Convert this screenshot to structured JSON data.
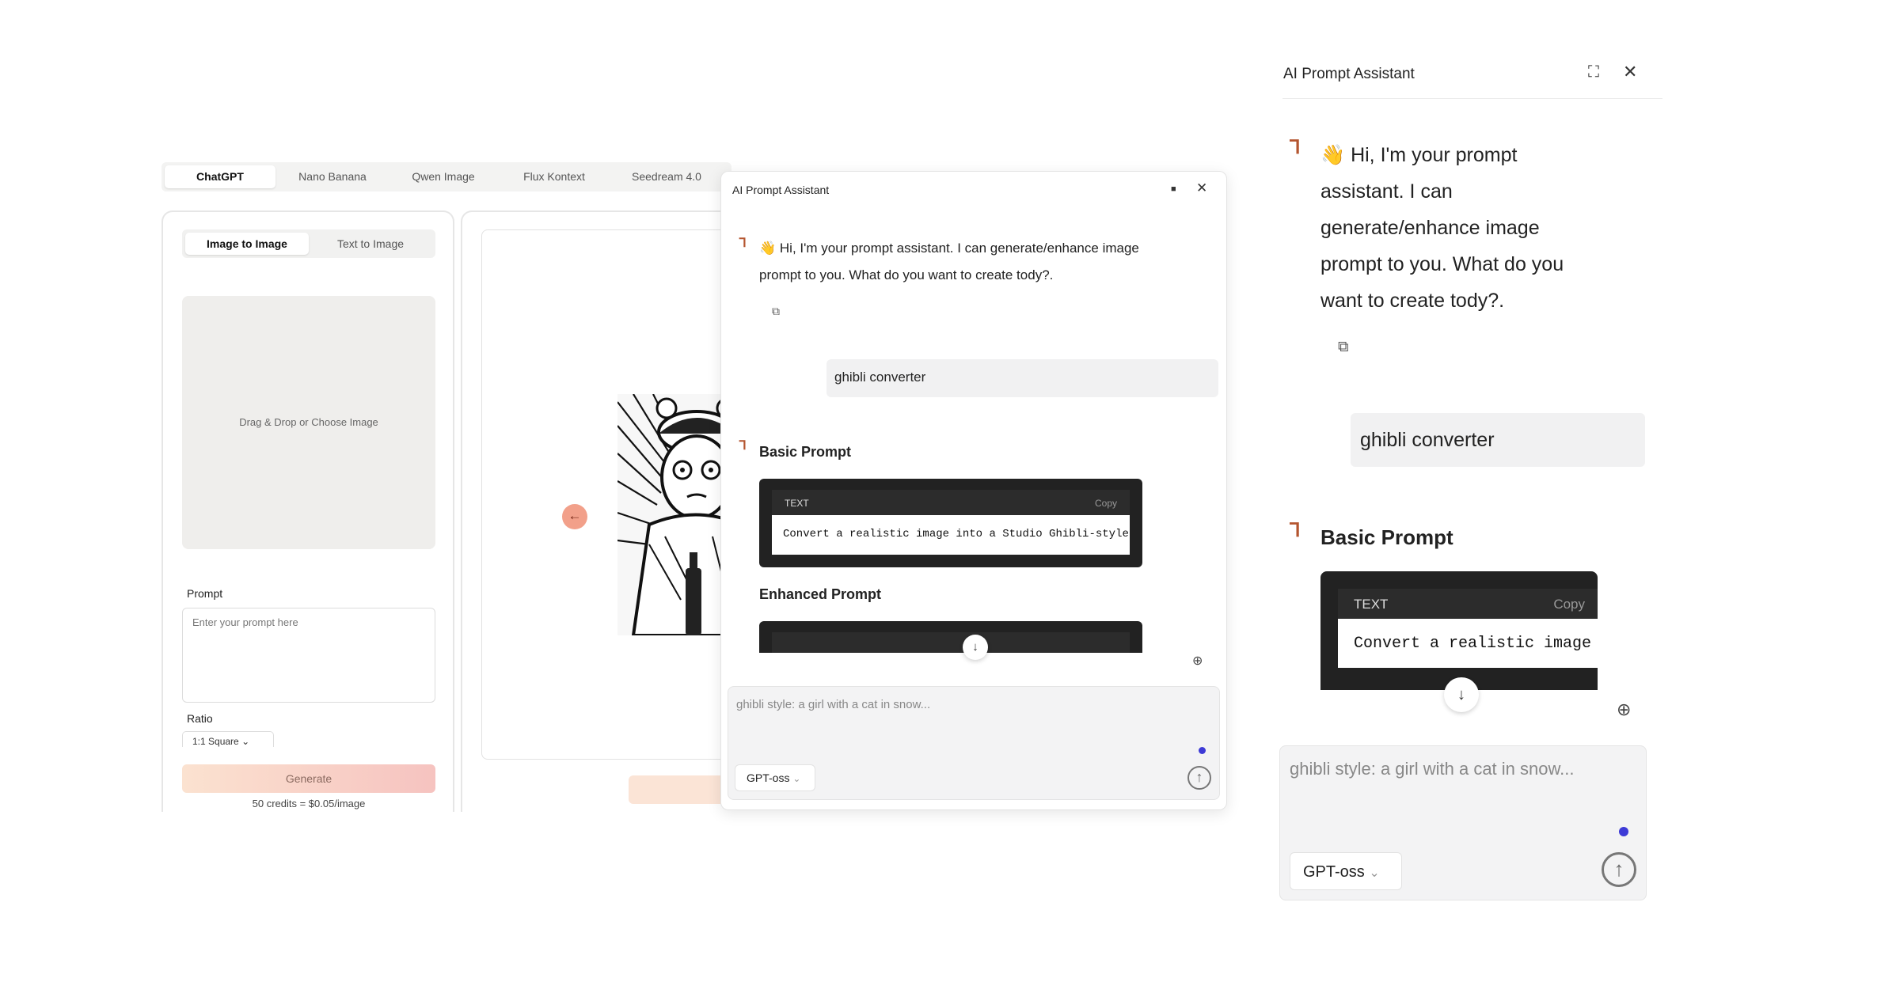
{
  "model_tabs": [
    "ChatGPT",
    "Nano Banana",
    "Qwen Image",
    "Flux Kontext",
    "Seedream 4.0"
  ],
  "mode_tabs": [
    "Image to Image",
    "Text to Image"
  ],
  "dropzone_text": "Drag & Drop or Choose Image",
  "prompt_label": "Prompt",
  "prompt_placeholder": "Enter your prompt here",
  "ratio_label": "Ratio",
  "ratio_value": "1:1 Square",
  "generate_label": "Generate",
  "credits_text": "50 credits = $0.05/image",
  "assistant": {
    "title": "AI Prompt Assistant",
    "greeting": "👋 Hi, I'm your prompt assistant. I can generate/enhance image prompt to you. What do you want to create tody?.",
    "user_message": "ghibli converter",
    "basic_prompt_heading": "Basic Prompt",
    "enhanced_prompt_heading": "Enhanced Prompt",
    "code_lang": "TEXT",
    "copy_label": "Copy",
    "code_text": "Convert a realistic image into a Studio Ghibli-style",
    "composer_placeholder": "ghibli style: a girl with a cat in snow...",
    "model_name": "GPT-oss"
  },
  "colors": {
    "accent_dot": "#3d3ad6",
    "generate_gradient_start": "#fbe2d0",
    "generate_gradient_end": "#f6c3c0",
    "prev_button": "#f2a08a",
    "code_bg": "#222222"
  }
}
